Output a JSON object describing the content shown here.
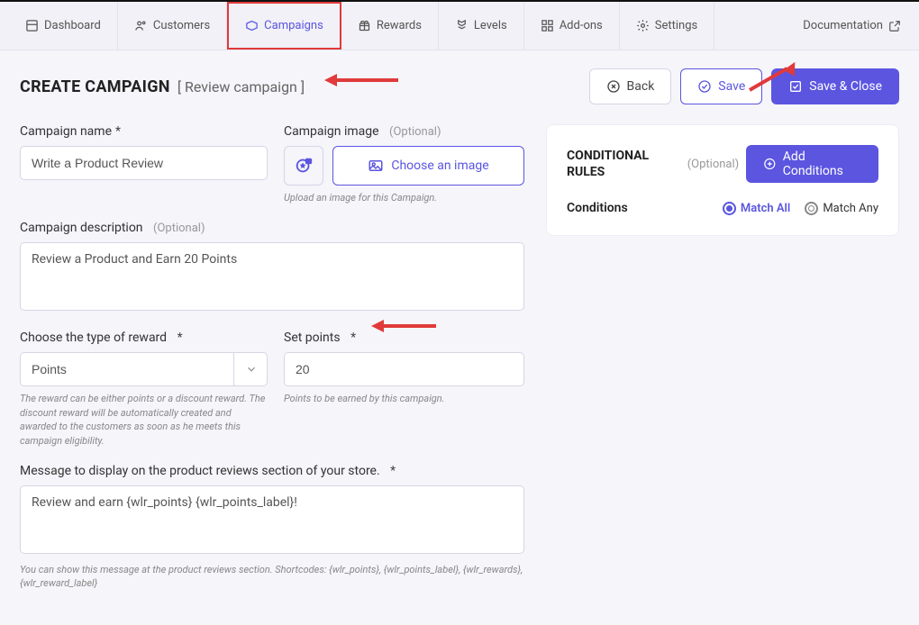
{
  "nav": {
    "items": [
      {
        "label": "Dashboard"
      },
      {
        "label": "Customers"
      },
      {
        "label": "Campaigns"
      },
      {
        "label": "Rewards"
      },
      {
        "label": "Levels"
      },
      {
        "label": "Add-ons"
      },
      {
        "label": "Settings"
      }
    ],
    "documentation": "Documentation"
  },
  "header": {
    "title": "CREATE CAMPAIGN",
    "subtitle": "[ Review campaign ]",
    "back": "Back",
    "save": "Save",
    "save_close": "Save & Close"
  },
  "form": {
    "name_label": "Campaign name",
    "name_value": "Write a Product Review",
    "image_label": "Campaign image",
    "choose_image": "Choose an image",
    "image_hint": "Upload an image for this Campaign.",
    "desc_label": "Campaign description",
    "desc_value": "Review a Product and Earn 20 Points",
    "reward_type_label": "Choose the type of reward",
    "reward_type_value": "Points",
    "reward_type_hint": "The reward can be either points or a discount reward. The discount reward will be automatically created and awarded to the customers as soon as he meets this campaign eligibility.",
    "points_label": "Set points",
    "points_value": "20",
    "points_hint": "Points to be earned by this campaign.",
    "message_label": "Message to display on the product reviews section of your store.",
    "message_value": "Review and earn {wlr_points} {wlr_points_label}!",
    "message_hint": "You can show this message at the product reviews section. Shortcodes: {wlr_points}, {wlr_points_label}, {wlr_rewards}, {wlr_reward_label}",
    "optional": "(Optional)",
    "req": "*"
  },
  "conditions": {
    "title": "CONDITIONAL RULES",
    "optional": "(Optional)",
    "add_button": "Add Conditions",
    "label": "Conditions",
    "match_all": "Match All",
    "match_any": "Match Any"
  }
}
